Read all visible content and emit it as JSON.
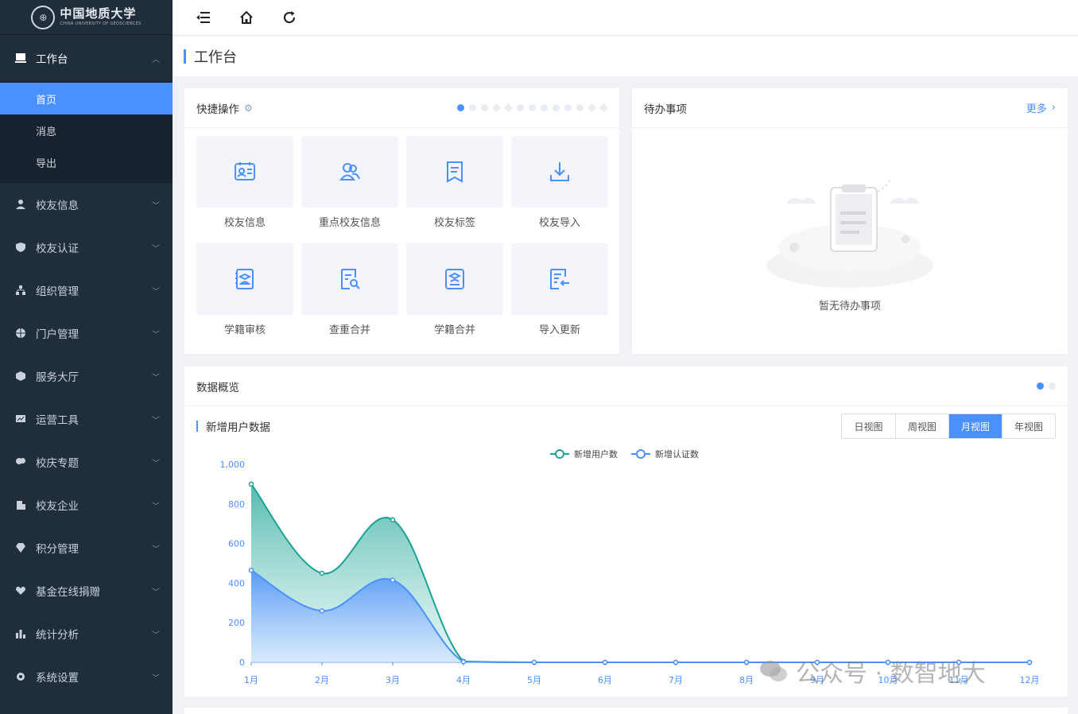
{
  "logo": {
    "name_cn": "中国地质大学",
    "name_en": "CHINA UNIVERSITY OF GEOSCIENCES"
  },
  "sidebar": {
    "workbench": {
      "label": "工作台",
      "icon": "monitor-icon"
    },
    "sub_items": [
      {
        "label": "首页",
        "active": true
      },
      {
        "label": "消息",
        "active": false
      },
      {
        "label": "导出",
        "active": false
      }
    ],
    "groups": [
      {
        "label": "校友信息",
        "icon": "user-icon"
      },
      {
        "label": "校友认证",
        "icon": "shield-icon"
      },
      {
        "label": "组织管理",
        "icon": "org-icon"
      },
      {
        "label": "门户管理",
        "icon": "globe-icon"
      },
      {
        "label": "服务大厅",
        "icon": "cube-icon"
      },
      {
        "label": "运营工具",
        "icon": "chart-board-icon"
      },
      {
        "label": "校庆专题",
        "icon": "balloon-icon"
      },
      {
        "label": "校友企业",
        "icon": "building-icon"
      },
      {
        "label": "积分管理",
        "icon": "diamond-icon"
      },
      {
        "label": "基金在线捐赠",
        "icon": "heart-hand-icon"
      },
      {
        "label": "统计分析",
        "icon": "bar-chart-icon"
      },
      {
        "label": "系统设置",
        "icon": "gear-icon"
      }
    ]
  },
  "topbar": {
    "icons": [
      "menu-fold-icon",
      "home-icon",
      "refresh-icon"
    ]
  },
  "page": {
    "title": "工作台"
  },
  "quick": {
    "title": "快捷操作",
    "items": [
      {
        "label": "校友信息",
        "icon": "id-card-icon"
      },
      {
        "label": "重点校友信息",
        "icon": "users-icon"
      },
      {
        "label": "校友标签",
        "icon": "tag-doc-icon"
      },
      {
        "label": "校友导入",
        "icon": "download-icon"
      },
      {
        "label": "学籍审核",
        "icon": "grad-check-icon"
      },
      {
        "label": "查重合并",
        "icon": "doc-search-icon"
      },
      {
        "label": "学籍合并",
        "icon": "grad-merge-icon"
      },
      {
        "label": "导入更新",
        "icon": "import-update-icon"
      }
    ]
  },
  "todo": {
    "title": "待办事项",
    "more": "更多",
    "empty_text": "暂无待办事项"
  },
  "overview": {
    "title": "数据概览",
    "sub_title": "新增用户数据",
    "views": [
      {
        "label": "日视图",
        "active": false
      },
      {
        "label": "周视图",
        "active": false
      },
      {
        "label": "月视图",
        "active": true
      },
      {
        "label": "年视图",
        "active": false
      }
    ]
  },
  "chart_data": {
    "type": "area",
    "categories": [
      "1月",
      "2月",
      "3月",
      "4月",
      "5月",
      "6月",
      "7月",
      "8月",
      "9月",
      "10月",
      "11月",
      "12月"
    ],
    "series": [
      {
        "name": "新增用户数",
        "values": [
          900,
          450,
          720,
          5,
          0,
          0,
          0,
          0,
          0,
          0,
          0,
          0
        ],
        "color": "#1aa394"
      },
      {
        "name": "新增认证数",
        "values": [
          465,
          260,
          415,
          3,
          0,
          0,
          0,
          0,
          0,
          0,
          0,
          0
        ],
        "color": "#4a90ff"
      }
    ],
    "ylim": [
      0,
      1000
    ],
    "yticks": [
      "0",
      "200",
      "400",
      "600",
      "800",
      "1,000"
    ],
    "legend": "top-center"
  },
  "watermark": {
    "text": "公众号 · 数智地大"
  }
}
